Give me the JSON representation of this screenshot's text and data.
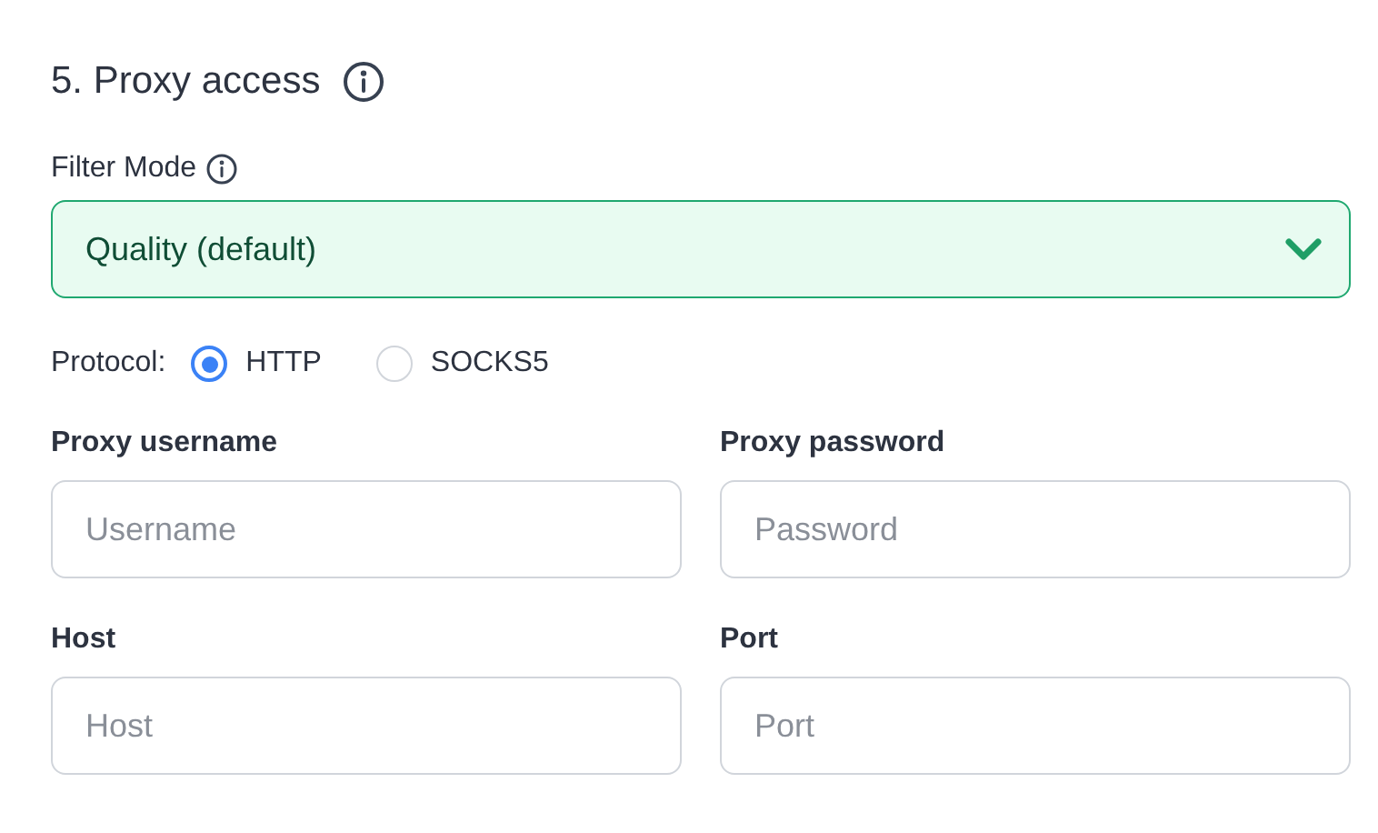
{
  "section": {
    "title": "5. Proxy access"
  },
  "filter_mode": {
    "label": "Filter Mode",
    "value": "Quality (default)"
  },
  "protocol": {
    "label": "Protocol:",
    "options": [
      {
        "label": "HTTP",
        "selected": true
      },
      {
        "label": "SOCKS5",
        "selected": false
      }
    ]
  },
  "fields": [
    {
      "label": "Proxy username",
      "placeholder": "Username"
    },
    {
      "label": "Proxy password",
      "placeholder": "Password"
    },
    {
      "label": "Host",
      "placeholder": "Host"
    },
    {
      "label": "Port",
      "placeholder": "Port"
    }
  ]
}
